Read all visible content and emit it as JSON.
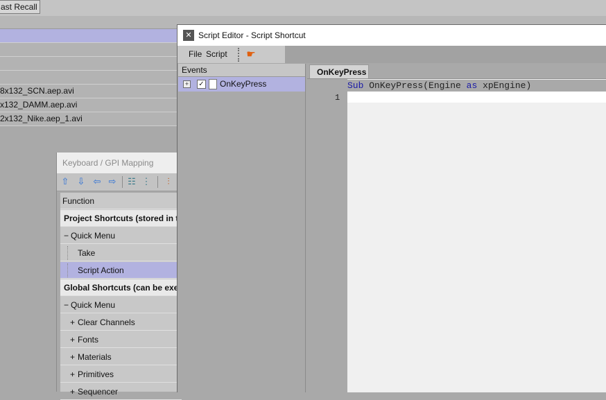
{
  "app": {
    "top_button_label": "ast Recall",
    "rows": [
      {
        "label": ""
      },
      {
        "label": ""
      },
      {
        "label": ""
      },
      {
        "label": ""
      },
      {
        "label": "8x132_SCN.aep.avi"
      },
      {
        "label": "x132_DAMM.aep.avi"
      },
      {
        "label": "2x132_Nike.aep_1.avi"
      }
    ]
  },
  "keyboard_mapping": {
    "title": "Keyboard / GPI Mapping",
    "toolbar_icons": [
      "arrow-up-icon",
      "arrow-down-icon",
      "arrow-left-icon",
      "arrow-right-icon",
      "tree-expand-icon",
      "tree-collapse-icon",
      "assign-key-icon"
    ],
    "column_header": "Function",
    "rows": [
      {
        "type": "group",
        "label": "Project Shortcuts (stored in t"
      },
      {
        "type": "node",
        "prefix": "−",
        "label": "Quick Menu"
      },
      {
        "type": "leaf",
        "prefix": "",
        "label": "Take"
      },
      {
        "type": "leaf",
        "prefix": "",
        "label": "Script Action",
        "selected": true
      },
      {
        "type": "group",
        "label": "Global Shortcuts (can be exec"
      },
      {
        "type": "node",
        "prefix": "−",
        "label": "Quick Menu"
      },
      {
        "type": "leaf",
        "prefix": "+",
        "label": "Clear Channels"
      },
      {
        "type": "leaf",
        "prefix": "+",
        "label": "Fonts"
      },
      {
        "type": "leaf",
        "prefix": "+",
        "label": "Materials"
      },
      {
        "type": "leaf",
        "prefix": "+",
        "label": "Primitives"
      },
      {
        "type": "leaf",
        "prefix": "+",
        "label": "Sequencer"
      }
    ]
  },
  "script_editor": {
    "title": "Script Editor - Script Shortcut",
    "menu": {
      "file": "File",
      "script": "Script"
    },
    "events_header": "Events",
    "event": {
      "expander": "+",
      "checkbox": "✓",
      "label": "OnKeyPress"
    },
    "tab_label": "OnKeyPress",
    "code": {
      "kw_sub": "Sub",
      "func": "OnKeyPress(Engine",
      "kw_as": "as",
      "type": "xpEngine)"
    },
    "line_number": "1"
  },
  "colors": {
    "selection": "#b2b2e0",
    "keyword": "#1a1aa6",
    "script_icon": "#e0600f",
    "nav_icon": "#2b6fd6"
  }
}
